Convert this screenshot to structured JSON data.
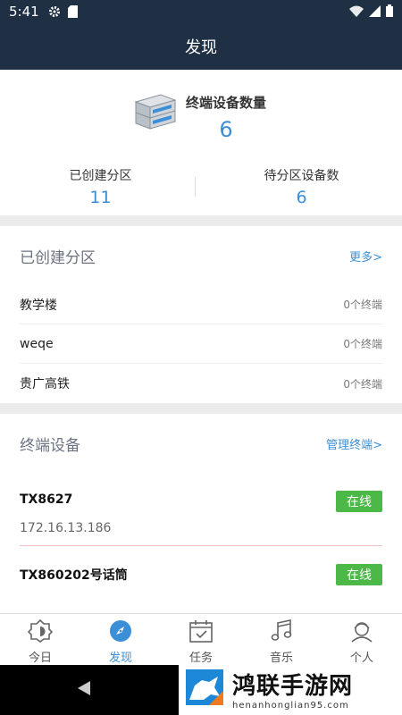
{
  "status_bar": {
    "time": "5:41"
  },
  "header": {
    "title": "发现"
  },
  "summary": {
    "device_count_label": "终端设备数量",
    "device_count_value": "6",
    "created_zones_label": "已创建分区",
    "created_zones_value": "11",
    "pending_devices_label": "待分区设备数",
    "pending_devices_value": "6"
  },
  "zones_section": {
    "title": "已创建分区",
    "more_link": "更多>",
    "items": [
      {
        "name": "教学楼",
        "count": "0个终端"
      },
      {
        "name": "weqe",
        "count": "0个终端"
      },
      {
        "name": "贵广高铁",
        "count": "0个终端"
      }
    ]
  },
  "terminals_section": {
    "title": "终端设备",
    "manage_link": "管理终端>",
    "items": [
      {
        "name": "TX8627",
        "ip": "172.16.13.186",
        "status": "在线"
      },
      {
        "name": "TX860202号话筒",
        "status": "在线"
      }
    ]
  },
  "tabbar": {
    "tabs": [
      {
        "label": "今日",
        "icon": "sun-icon"
      },
      {
        "label": "发现",
        "icon": "compass-icon",
        "active": true
      },
      {
        "label": "任务",
        "icon": "calendar-icon"
      },
      {
        "label": "音乐",
        "icon": "music-icon"
      },
      {
        "label": "个人",
        "icon": "user-icon"
      }
    ]
  },
  "watermark": {
    "title": "鸿联手游网",
    "url": "henanhonglian95.com"
  },
  "colors": {
    "header_bg": "#1f2f44",
    "accent": "#3b8fd6",
    "online": "#4cb848"
  }
}
